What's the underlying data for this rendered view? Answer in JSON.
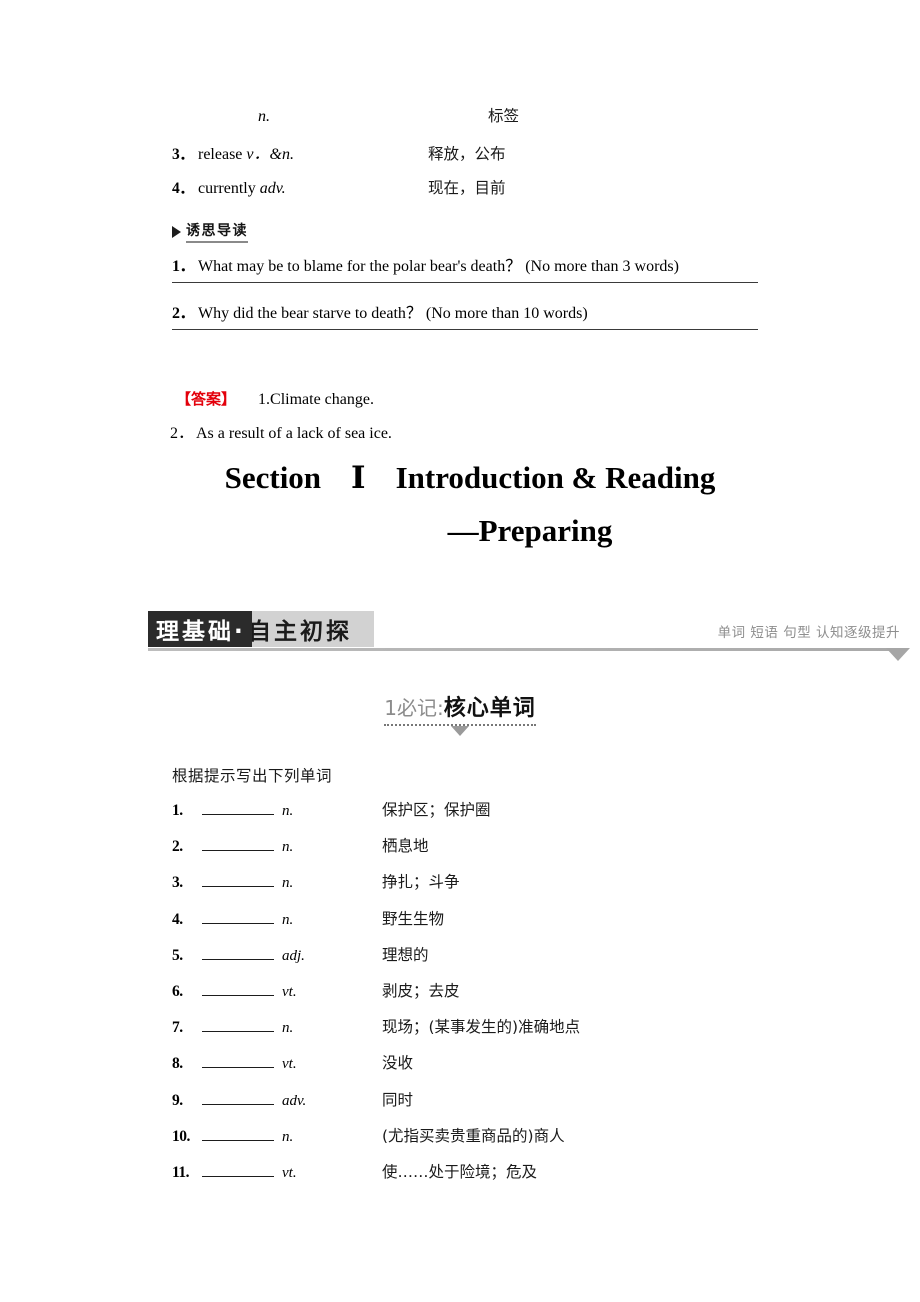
{
  "vocab_fragment": [
    {
      "num": "",
      "english": "",
      "pos": "n.",
      "chinese": "标签",
      "indent": true
    },
    {
      "num": "3．",
      "english": "release",
      "pos": "v．&n.",
      "chinese": "释放，公布",
      "indent": false
    },
    {
      "num": "4．",
      "english": "currently",
      "pos": "adv.",
      "chinese": "现在，目前",
      "indent": false
    }
  ],
  "reading_guide": {
    "marker_label": "诱思导读",
    "questions": [
      {
        "num": "1．",
        "text": "What may be to blame for the polar bear's death？ (No more than 3 words)"
      },
      {
        "num": "2．",
        "text": "Why did the bear starve to death？ (No more than 10 words)"
      }
    ],
    "answer": {
      "label": "【答案】",
      "line1": "1.Climate change.",
      "num2": "2．",
      "line2": "As a result of a lack of sea ice."
    },
    "answer_color": "#e3000b"
  },
  "section_title": {
    "word_section": "Section",
    "numeral": "Ⅰ",
    "subject": "Introduction & Reading",
    "subtitle": "—Preparing"
  },
  "banner": {
    "dark_text": "理基础·",
    "light_text": "自主初探",
    "sub_text": "单词 短语 句型 认知逐级提升",
    "dark_color": "#2b2b2b",
    "light_color": "#d2d2d2",
    "rule_color": "#a9a9a9"
  },
  "subheading": {
    "prefix": "1必记:",
    "title": "核心单词"
  },
  "wordlist": {
    "instruction": "根据提示写出下列单词",
    "items": [
      {
        "num": "1.",
        "pos": "n.",
        "chinese": "保护区；保护圈"
      },
      {
        "num": "2.",
        "pos": "n.",
        "chinese": "栖息地"
      },
      {
        "num": "3.",
        "pos": "n.",
        "chinese": "挣扎；斗争"
      },
      {
        "num": "4.",
        "pos": "n.",
        "chinese": "野生生物"
      },
      {
        "num": "5.",
        "pos": "adj.",
        "chinese": "理想的"
      },
      {
        "num": "6.",
        "pos": "vt.",
        "chinese": "剥皮；去皮"
      },
      {
        "num": "7.",
        "pos": "n.",
        "chinese": "现场；(某事发生的)准确地点"
      },
      {
        "num": "8.",
        "pos": "vt.",
        "chinese": "没收"
      },
      {
        "num": "9.",
        "pos": "adv.",
        "chinese": "同时"
      },
      {
        "num": "10.",
        "pos": "n.",
        "chinese": "(尤指买卖贵重商品的)商人"
      },
      {
        "num": "11.",
        "pos": "vt.",
        "chinese": "使……处于险境；危及"
      }
    ]
  }
}
